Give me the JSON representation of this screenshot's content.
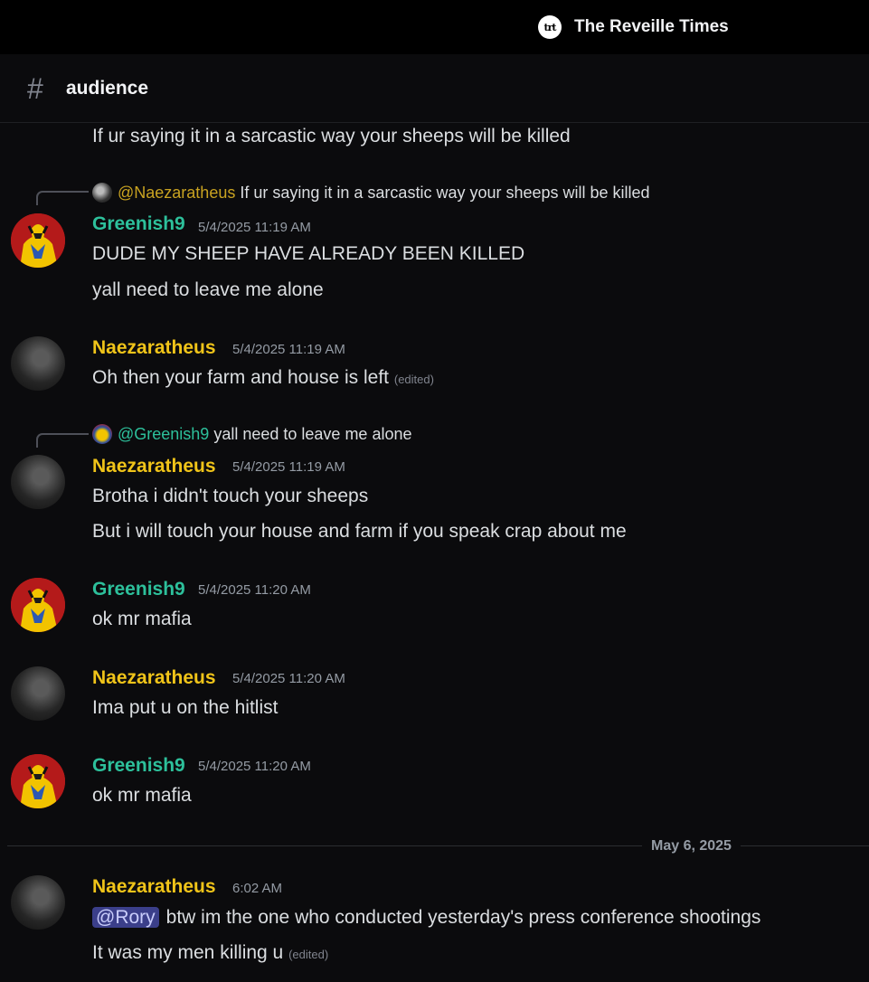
{
  "server": {
    "icon_text": "trt",
    "name": "The Reveille Times"
  },
  "channel": {
    "hash": "#",
    "name": "audience"
  },
  "messages": {
    "m0": {
      "text": "If ur saying it in a sarcastic  way your sheeps will be killed"
    },
    "m1": {
      "reply": {
        "mention": "@Naezaratheus",
        "text": "If ur saying it in a sarcastic  way your sheeps will be killed"
      },
      "author": "Greenish9",
      "timestamp": "5/4/2025 11:19 AM",
      "line1": "DUDE MY SHEEP HAVE ALREADY BEEN KILLED",
      "line2": "yall need to leave me alone"
    },
    "m2": {
      "author": "Naezaratheus",
      "timestamp": "5/4/2025 11:19 AM",
      "line1": "Oh then your farm and house is left",
      "edited": "(edited)"
    },
    "m3": {
      "reply": {
        "mention": "@Greenish9",
        "text": "yall need to leave me alone"
      },
      "author": "Naezaratheus",
      "timestamp": "5/4/2025 11:19 AM",
      "line1": "Brotha i didn't touch your sheeps",
      "line2": "But i will touch your house and farm if you speak crap about me"
    },
    "m4": {
      "author": "Greenish9",
      "timestamp": "5/4/2025 11:20 AM",
      "line1": "ok mr mafia"
    },
    "m5": {
      "author": "Naezaratheus",
      "timestamp": "5/4/2025 11:20 AM",
      "line1": "Ima put u on the hitlist"
    },
    "m6": {
      "author": "Greenish9",
      "timestamp": "5/4/2025 11:20 AM",
      "line1": "ok mr mafia"
    },
    "date_divider": "May 6, 2025",
    "m7": {
      "author": "Naezaratheus",
      "timestamp": "6:02 AM",
      "mention": "@Rory",
      "line1": "btw im the one who conducted yesterday's press conference shootings",
      "line2": "It was my men killing  u",
      "edited": "(edited)"
    }
  },
  "colors": {
    "greenish": "#2dc09b",
    "naezaratheus": "#f0c419",
    "mention_bg": "#3b3f8a"
  }
}
